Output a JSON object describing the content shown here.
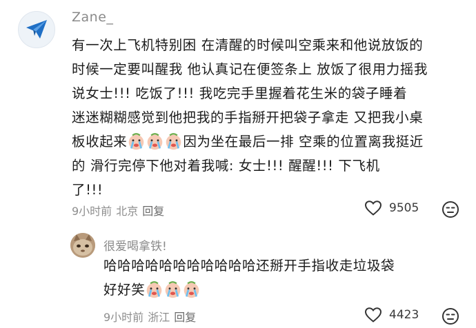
{
  "comment": {
    "username": "Zane_",
    "lines": [
      "有一次上飞机特别困 在清醒的时候叫空乘来和他说放饭的",
      "时候一定要叫醒我 他认真记在便签条上 放饭了很用力摇我",
      "说女士!!! 吃饭了!!!  我吃完手里握着花生米的袋子睡着",
      "迷迷糊糊感觉到他把我的手指掰开把袋子拿走 又把我小桌",
      "板收起来",
      "因为坐在最后一排 空乘的位置离我挺近",
      "的 滑行完停下他对着我喊: 女士!!! 醒醒!!! 下飞机",
      "了!!!"
    ],
    "time": "9小时前",
    "location": "北京",
    "reply_label": "回复",
    "likes": "9505"
  },
  "reply": {
    "username": "很爱喝拿铁!",
    "lines": [
      "哈哈哈哈哈哈哈哈哈哈哈还掰开手指收走垃圾袋",
      "好好笑"
    ],
    "time": "9小时前",
    "location": "浙江",
    "reply_label": "回复",
    "likes": "4423"
  },
  "icons": {
    "avatar": "paper-plane-icon",
    "emoji": "loudly-crying-face-icon",
    "like": "heart-outline-icon",
    "dislike": "neutral-face-icon"
  },
  "colors": {
    "plane_blue": "#1f6fc5",
    "meta_gray": "#8e8e8e"
  }
}
